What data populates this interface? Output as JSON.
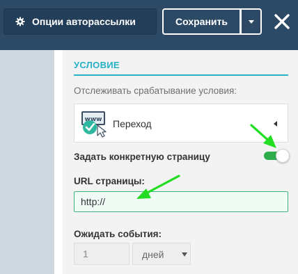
{
  "toolbar": {
    "options_label": "Опции авторассылки",
    "save_label": "Сохранить"
  },
  "condition": {
    "section_title": "УСЛОВИЕ",
    "track_label": "Отслеживать срабатывание условия:",
    "selected_condition": "Переход",
    "condition_icon_text": "www",
    "specific_page_label": "Задать конкретную страницу",
    "specific_page_enabled": true,
    "url_label": "URL страницы:",
    "url_value": "http://",
    "wait_label": "Ожидать события:",
    "wait_value": "1",
    "wait_unit": "дней"
  },
  "colors": {
    "topbar": "#2c4a66",
    "accent": "#26b0c6",
    "toggle_on": "#2eac4e",
    "annotation_arrow": "#22dd22"
  }
}
